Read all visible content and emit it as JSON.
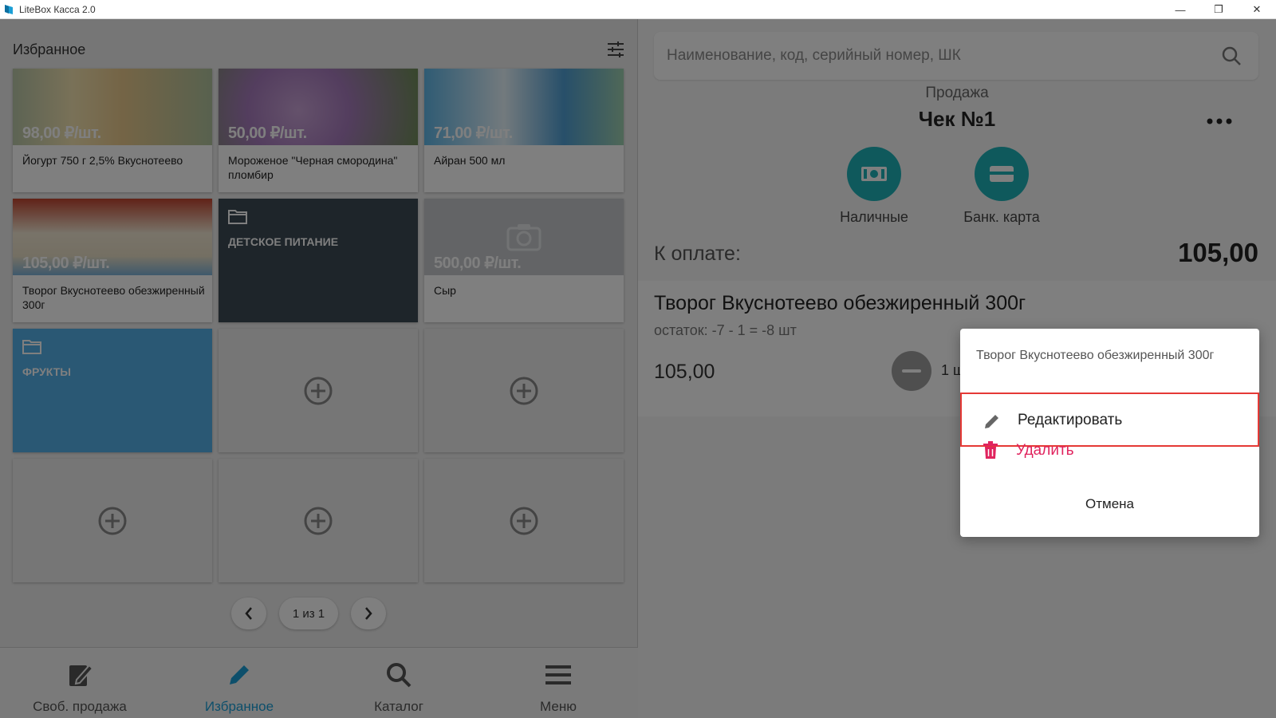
{
  "window": {
    "title": "LiteBox Касса 2.0",
    "minimize": "—",
    "restore": "❐",
    "close": "✕"
  },
  "favorites": {
    "title": "Избранное",
    "tiles": [
      {
        "type": "product",
        "price": "98,00 ₽/шт.",
        "name": "Йогурт 750 г 2,5% Вкуснотеево"
      },
      {
        "type": "product",
        "price": "50,00 ₽/шт.",
        "name": "Мороженое \"Черная смородина\" пломбир"
      },
      {
        "type": "product",
        "price": "71,00 ₽/шт.",
        "name": "Айран 500 мл"
      },
      {
        "type": "product",
        "price": "105,00 ₽/шт.",
        "name": "Творог Вкуснотеево обезжиренный 300г"
      },
      {
        "type": "folder",
        "name": "ДЕТСКОЕ ПИТАНИЕ"
      },
      {
        "type": "product",
        "price": "500,00 ₽/шт.",
        "name": "Сыр"
      },
      {
        "type": "folder",
        "name": "ФРУКТЫ"
      }
    ],
    "pager": {
      "text": "1 из 1"
    }
  },
  "bottom_nav": {
    "items": [
      {
        "label": "Своб. продажа",
        "icon": "free-sale-icon"
      },
      {
        "label": "Избранное",
        "icon": "pencil-icon",
        "active": true
      },
      {
        "label": "Каталог",
        "icon": "search-icon"
      },
      {
        "label": "Меню",
        "icon": "menu-icon"
      }
    ]
  },
  "sale": {
    "search_placeholder": "Наименование, код, серийный номер, ШК",
    "mode": "Продажа",
    "check": "Чек №1",
    "payments": [
      {
        "label": "Наличные",
        "icon": "cash-icon"
      },
      {
        "label": "Банк. карта",
        "icon": "card-icon"
      }
    ],
    "due_label": "К оплате:",
    "due_amount": "105,00",
    "item": {
      "name": "Творог Вкуснотеево обезжиренный 300г",
      "stock": "остаток: -7 - 1 = -8 шт",
      "price": "105,00",
      "qty": "1 ш"
    }
  },
  "dialog": {
    "title": "Творог Вкуснотеево обезжиренный 300г",
    "edit": "Редактировать",
    "delete": "Удалить",
    "cancel": "Отмена"
  },
  "colors": {
    "accent": "#1b9fd6",
    "teal": "#1fb3b9",
    "danger": "#e0245e",
    "highlight": "#e53935"
  }
}
